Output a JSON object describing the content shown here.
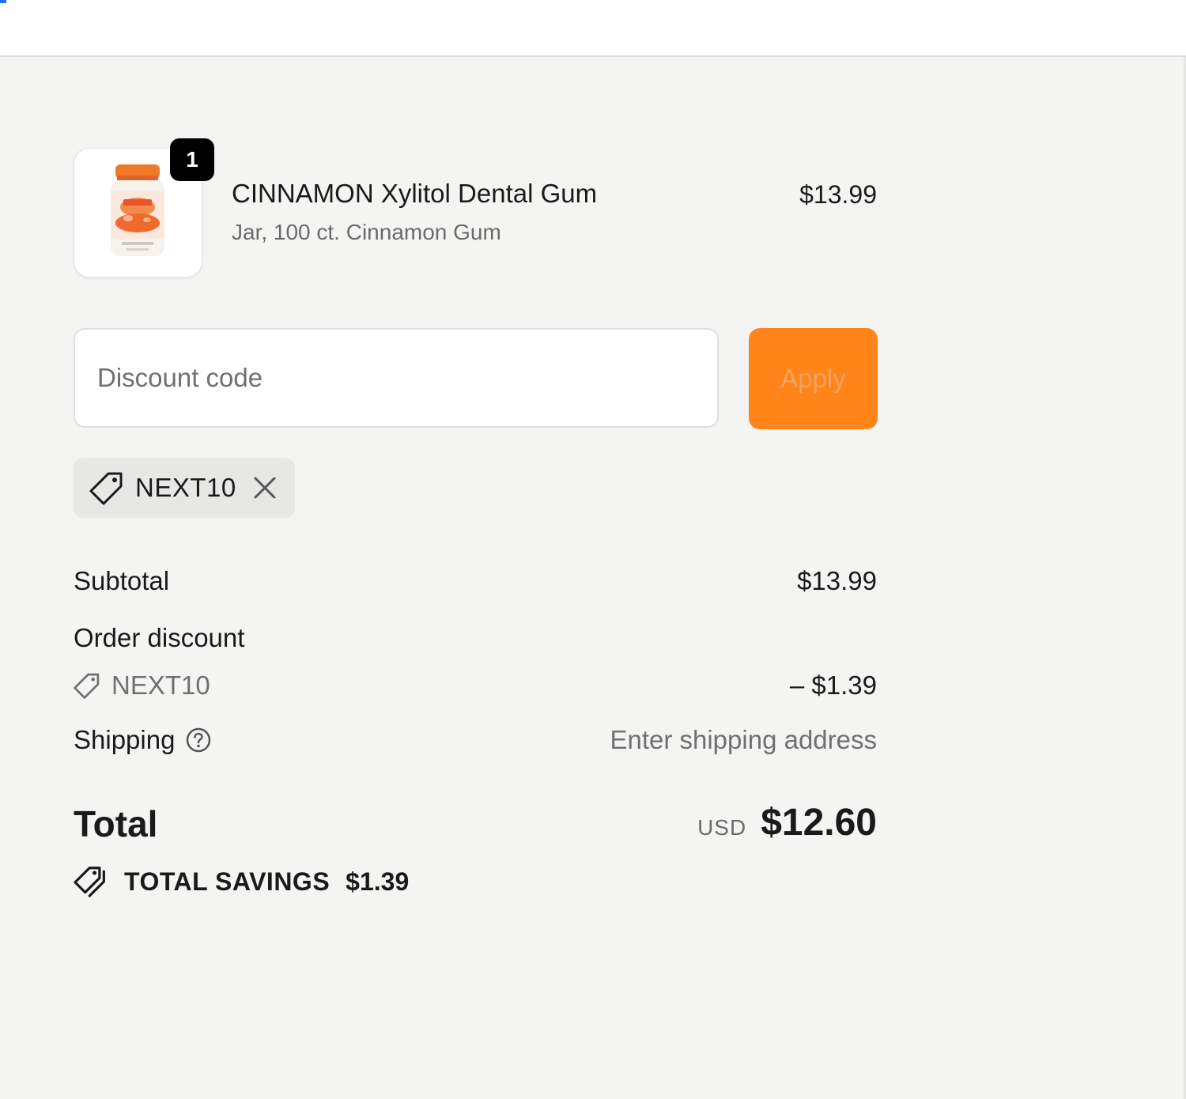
{
  "product": {
    "quantity": "1",
    "name": "CINNAMON Xylitol Dental Gum",
    "variant": "Jar, 100 ct. Cinnamon Gum",
    "price": "$13.99"
  },
  "discount": {
    "placeholder": "Discount code",
    "value": "",
    "apply_label": "Apply",
    "applied_code": "NEXT10"
  },
  "summary": {
    "subtotal_label": "Subtotal",
    "subtotal_value": "$13.99",
    "order_discount_label": "Order discount",
    "order_discount_code": "NEXT10",
    "order_discount_value": "– $1.39",
    "shipping_label": "Shipping",
    "shipping_value": "Enter shipping address",
    "total_label": "Total",
    "currency": "USD",
    "total_value": "$12.60",
    "savings_label": "TOTAL SAVINGS",
    "savings_value": "$1.39"
  },
  "icons": {
    "tag": "tag-icon",
    "remove": "close-icon",
    "help": "question-circle-icon",
    "savings": "tags-icon"
  },
  "colors": {
    "accent": "#ff8419",
    "background": "#f4f4f3",
    "badge": "#000000"
  }
}
